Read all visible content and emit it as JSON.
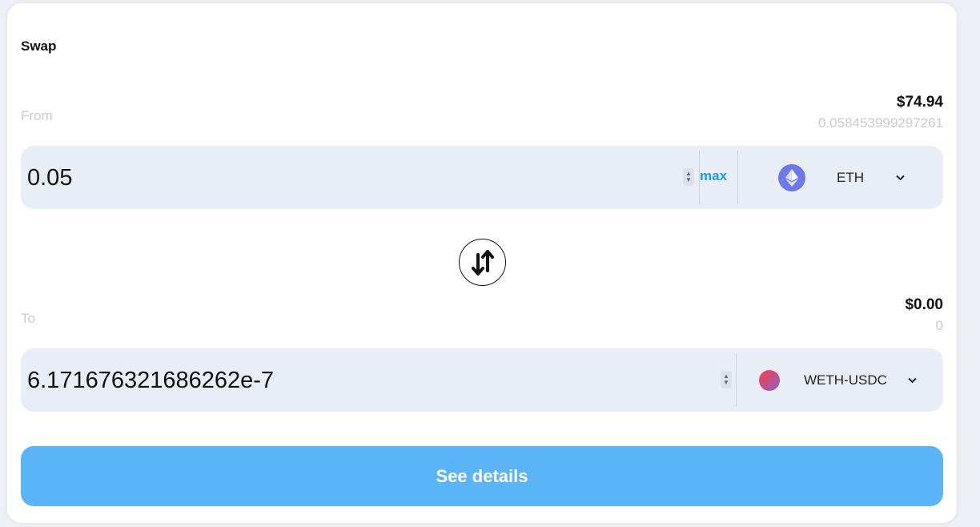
{
  "title": "Swap",
  "from": {
    "label": "From",
    "usd_value": "$74.94",
    "balance": "0.058453999297261",
    "amount": "0.05",
    "max_label": "max",
    "token": {
      "name": "ETH",
      "icon": "ethereum-icon",
      "color": "#6b7ae8"
    }
  },
  "to": {
    "label": "To",
    "usd_value": "$0.00",
    "balance": "0",
    "amount": "6.171676321686262e-7",
    "token": {
      "name": "WETH-USDC",
      "icon": "weth-usdc-icon"
    }
  },
  "swap_button_icon": "swap-arrows-icon",
  "details_button": "See details",
  "colors": {
    "accent": "#1b9ae8",
    "button": "#5bb4f7",
    "field_bg": "#e9edf6"
  }
}
